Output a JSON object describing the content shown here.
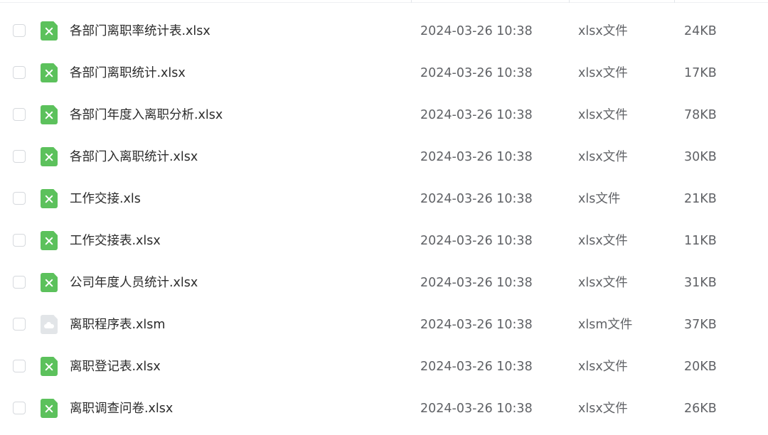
{
  "files": [
    {
      "name": "各部门离职率统计表.xlsx",
      "modified": "2024-03-26 10:38",
      "type": "xlsx文件",
      "size": "24KB",
      "icon": "excel-file-icon"
    },
    {
      "name": "各部门离职统计.xlsx",
      "modified": "2024-03-26 10:38",
      "type": "xlsx文件",
      "size": "17KB",
      "icon": "excel-file-icon"
    },
    {
      "name": "各部门年度入离职分析.xlsx",
      "modified": "2024-03-26 10:38",
      "type": "xlsx文件",
      "size": "78KB",
      "icon": "excel-file-icon"
    },
    {
      "name": "各部门入离职统计.xlsx",
      "modified": "2024-03-26 10:38",
      "type": "xlsx文件",
      "size": "30KB",
      "icon": "excel-file-icon"
    },
    {
      "name": "工作交接.xls",
      "modified": "2024-03-26 10:38",
      "type": "xls文件",
      "size": "21KB",
      "icon": "excel-file-icon"
    },
    {
      "name": "工作交接表.xlsx",
      "modified": "2024-03-26 10:38",
      "type": "xlsx文件",
      "size": "11KB",
      "icon": "excel-file-icon"
    },
    {
      "name": "公司年度人员统计.xlsx",
      "modified": "2024-03-26 10:38",
      "type": "xlsx文件",
      "size": "31KB",
      "icon": "excel-file-icon"
    },
    {
      "name": "离职程序表.xlsm",
      "modified": "2024-03-26 10:38",
      "type": "xlsm文件",
      "size": "37KB",
      "icon": "cloud-file-icon"
    },
    {
      "name": "离职登记表.xlsx",
      "modified": "2024-03-26 10:38",
      "type": "xlsx文件",
      "size": "20KB",
      "icon": "excel-file-icon"
    },
    {
      "name": "离职调查问卷.xlsx",
      "modified": "2024-03-26 10:38",
      "type": "xlsx文件",
      "size": "26KB",
      "icon": "excel-file-icon"
    }
  ],
  "colors": {
    "excel_icon": "#5cc15c",
    "cloud_icon": "#e2e5e8",
    "name_text": "#2b2b2b",
    "meta_text": "#606266"
  }
}
